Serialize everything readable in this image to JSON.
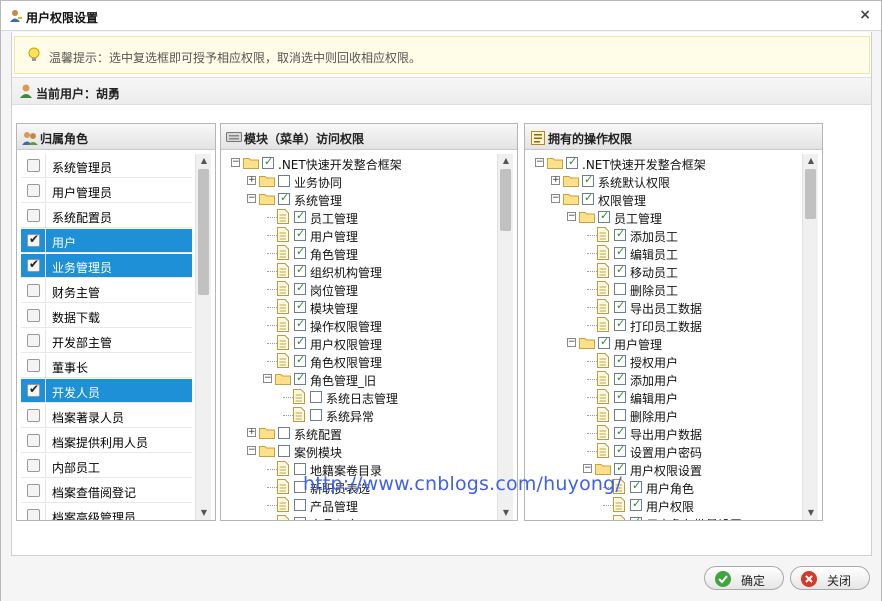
{
  "window": {
    "title": "用户权限设置",
    "close_glyph": "×"
  },
  "tip": {
    "text": "温馨提示：选中复选框即可授予相应权限，取消选中则回收相应权限。"
  },
  "user": {
    "label": "当前用户：胡勇"
  },
  "roles_panel": {
    "title": "归属角色",
    "items": [
      {
        "label": "系统管理员",
        "checked": false,
        "selected": false
      },
      {
        "label": "用户管理员",
        "checked": false,
        "selected": false
      },
      {
        "label": "系统配置员",
        "checked": false,
        "selected": false
      },
      {
        "label": "用户",
        "checked": true,
        "selected": true
      },
      {
        "label": "业务管理员",
        "checked": true,
        "selected": true
      },
      {
        "label": "财务主管",
        "checked": false,
        "selected": false
      },
      {
        "label": "数据下载",
        "checked": false,
        "selected": false
      },
      {
        "label": "开发部主管",
        "checked": false,
        "selected": false
      },
      {
        "label": "董事长",
        "checked": false,
        "selected": false
      },
      {
        "label": "开发人员",
        "checked": true,
        "selected": true
      },
      {
        "label": "档案著录人员",
        "checked": false,
        "selected": false
      },
      {
        "label": "档案提供利用人员",
        "checked": false,
        "selected": false
      },
      {
        "label": "内部员工",
        "checked": false,
        "selected": false
      },
      {
        "label": "档案查借阅登记",
        "checked": false,
        "selected": false
      },
      {
        "label": "档案高级管理员",
        "checked": false,
        "selected": false
      }
    ]
  },
  "modules_panel": {
    "title": "模块（菜单）访问权限",
    "nodes": [
      {
        "label": ".NET快速开发整合框架",
        "depth": 0,
        "kind": "folder",
        "expander": "minus",
        "checked": true
      },
      {
        "label": "业务协同",
        "depth": 1,
        "kind": "folder",
        "expander": "plus",
        "checked": false
      },
      {
        "label": "系统管理",
        "depth": 1,
        "kind": "folder",
        "expander": "minus",
        "checked": true
      },
      {
        "label": "员工管理",
        "depth": 2,
        "kind": "page",
        "checked": true
      },
      {
        "label": "用户管理",
        "depth": 2,
        "kind": "page",
        "checked": true
      },
      {
        "label": "角色管理",
        "depth": 2,
        "kind": "page",
        "checked": true
      },
      {
        "label": "组织机构管理",
        "depth": 2,
        "kind": "page",
        "checked": true
      },
      {
        "label": "岗位管理",
        "depth": 2,
        "kind": "page",
        "checked": true
      },
      {
        "label": "模块管理",
        "depth": 2,
        "kind": "page",
        "checked": true
      },
      {
        "label": "操作权限管理",
        "depth": 2,
        "kind": "page",
        "checked": true
      },
      {
        "label": "用户权限管理",
        "depth": 2,
        "kind": "page",
        "checked": true
      },
      {
        "label": "角色权限管理",
        "depth": 2,
        "kind": "page",
        "checked": true
      },
      {
        "label": "角色管理_旧",
        "depth": 2,
        "kind": "folder",
        "expander": "minus",
        "checked": true
      },
      {
        "label": "系统日志管理",
        "depth": 3,
        "kind": "page",
        "checked": false
      },
      {
        "label": "系统异常",
        "depth": 3,
        "kind": "page",
        "checked": false
      },
      {
        "label": "系统配置",
        "depth": 1,
        "kind": "folder",
        "expander": "plus",
        "checked": false
      },
      {
        "label": "案例模块",
        "depth": 1,
        "kind": "folder",
        "expander": "minus",
        "checked": false
      },
      {
        "label": "地籍案卷目录",
        "depth": 2,
        "kind": "page",
        "checked": false
      },
      {
        "label": "新职员表选",
        "depth": 2,
        "kind": "page",
        "checked": false
      },
      {
        "label": "产品管理",
        "depth": 2,
        "kind": "page",
        "checked": false
      },
      {
        "label": "产品入库",
        "depth": 2,
        "kind": "page",
        "checked": false
      }
    ]
  },
  "operations_panel": {
    "title": "拥有的操作权限",
    "nodes": [
      {
        "label": ".NET快速开发整合框架",
        "depth": 0,
        "kind": "folder",
        "expander": "minus",
        "checked": true
      },
      {
        "label": "系统默认权限",
        "depth": 1,
        "kind": "folder",
        "expander": "plus",
        "checked": true
      },
      {
        "label": "权限管理",
        "depth": 1,
        "kind": "folder",
        "expander": "minus",
        "checked": true
      },
      {
        "label": "员工管理",
        "depth": 2,
        "kind": "folder",
        "expander": "minus",
        "checked": true
      },
      {
        "label": "添加员工",
        "depth": 3,
        "kind": "page",
        "checked": true
      },
      {
        "label": "编辑员工",
        "depth": 3,
        "kind": "page",
        "checked": true
      },
      {
        "label": "移动员工",
        "depth": 3,
        "kind": "page",
        "checked": true
      },
      {
        "label": "删除员工",
        "depth": 3,
        "kind": "page",
        "checked": false
      },
      {
        "label": "导出员工数据",
        "depth": 3,
        "kind": "page",
        "checked": true
      },
      {
        "label": "打印员工数据",
        "depth": 3,
        "kind": "page",
        "checked": true
      },
      {
        "label": "用户管理",
        "depth": 2,
        "kind": "folder",
        "expander": "minus",
        "checked": true
      },
      {
        "label": "授权用户",
        "depth": 3,
        "kind": "page",
        "checked": true
      },
      {
        "label": "添加用户",
        "depth": 3,
        "kind": "page",
        "checked": true
      },
      {
        "label": "编辑用户",
        "depth": 3,
        "kind": "page",
        "checked": true
      },
      {
        "label": "删除用户",
        "depth": 3,
        "kind": "page",
        "checked": false
      },
      {
        "label": "导出用户数据",
        "depth": 3,
        "kind": "page",
        "checked": true
      },
      {
        "label": "设置用户密码",
        "depth": 3,
        "kind": "page",
        "checked": true
      },
      {
        "label": "用户权限设置",
        "depth": 3,
        "kind": "folder",
        "expander": "minus",
        "checked": true
      },
      {
        "label": "用户角色",
        "depth": 4,
        "kind": "page",
        "checked": true
      },
      {
        "label": "用户权限",
        "depth": 4,
        "kind": "page",
        "checked": true
      },
      {
        "label": "用户角色批量设置",
        "depth": 4,
        "kind": "page",
        "checked": true
      }
    ]
  },
  "watermark": {
    "text": "http://www.cnblogs.com/huyong/"
  },
  "buttons": {
    "ok_label": "确定",
    "close_label": "关闭"
  },
  "colors": {
    "selection": "#1e90d8",
    "ok_icon": "#3fa63f",
    "close_icon": "#d23a2a",
    "watermark": "#3f61e4"
  },
  "icons": {
    "title": "user-key-icon",
    "tip": "lightbulb-icon",
    "user": "user-icon",
    "roles": "group-icon",
    "modules": "keyboard-icon",
    "operations": "checklist-icon",
    "ok": "check-icon",
    "close": "cross-icon"
  }
}
